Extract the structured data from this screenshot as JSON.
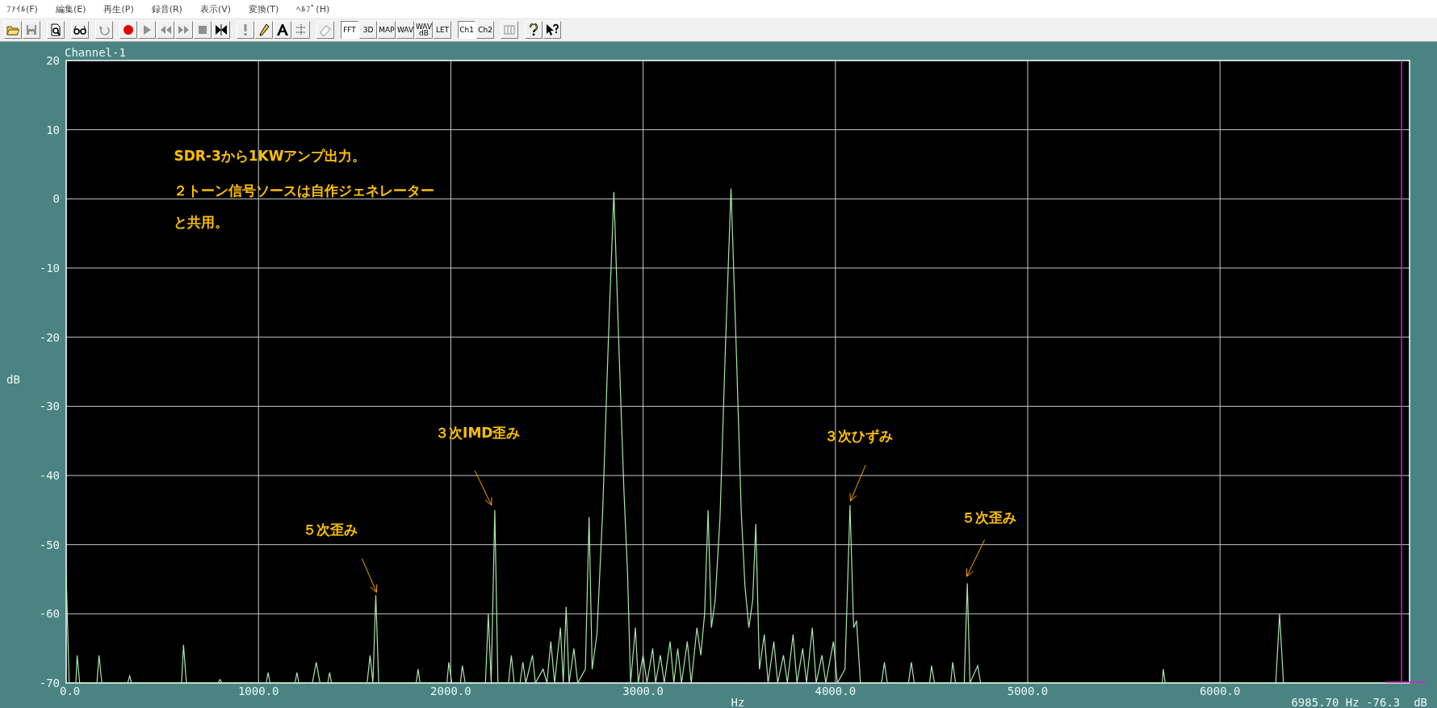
{
  "menu": [
    "ﾌｧｲﾙ(F)",
    "編集(E)",
    "再生(P)",
    "録音(R)",
    "表示(V)",
    "変換(T)",
    "ﾍﾙﾌﾟ(H)"
  ],
  "toolbar": [
    [
      {
        "kind": "open",
        "disabled": false
      },
      {
        "kind": "save",
        "disabled": true
      }
    ],
    [
      {
        "kind": "preview",
        "disabled": false
      }
    ],
    [
      {
        "kind": "glasses",
        "disabled": false
      }
    ],
    [
      {
        "kind": "undo",
        "disabled": true
      }
    ],
    [
      {
        "kind": "record",
        "disabled": false
      },
      {
        "kind": "play",
        "disabled": true
      },
      {
        "kind": "rewind",
        "disabled": true
      },
      {
        "kind": "forward",
        "disabled": true
      },
      {
        "kind": "stop",
        "disabled": true
      },
      {
        "kind": "mark",
        "disabled": false
      }
    ],
    [
      {
        "kind": "exclaim",
        "disabled": true
      },
      {
        "kind": "pencil",
        "disabled": false
      },
      {
        "kind": "font",
        "disabled": false
      },
      {
        "kind": "dots",
        "disabled": false
      }
    ],
    [
      {
        "kind": "eraser",
        "disabled": false
      }
    ],
    [
      {
        "kind": "text",
        "label": "FFT",
        "pressed": true
      },
      {
        "kind": "text",
        "label": "3D",
        "pressed": false
      },
      {
        "kind": "text",
        "label": "MAP",
        "pressed": false
      },
      {
        "kind": "text",
        "label": "WAV",
        "pressed": false
      },
      {
        "kind": "text",
        "label": "WAV\ndB",
        "pressed": false
      },
      {
        "kind": "text",
        "label": "LET",
        "pressed": false
      }
    ],
    [
      {
        "kind": "text",
        "label": "Ch1",
        "pressed": true
      },
      {
        "kind": "text",
        "label": "Ch2",
        "pressed": false
      }
    ],
    [
      {
        "kind": "columns",
        "disabled": true
      }
    ],
    [
      {
        "kind": "help",
        "disabled": false
      },
      {
        "kind": "pointerhelp",
        "disabled": false
      }
    ]
  ],
  "channel_label": "Channel-1",
  "chart_data": {
    "type": "line",
    "xlabel": "Hz",
    "ylabel": "dB",
    "xlim": [
      0,
      6985.7
    ],
    "ylim": [
      -70,
      20
    ],
    "xticks": [
      {
        "value": 0,
        "label": "0.0"
      },
      {
        "value": 1000,
        "label": "1000.0"
      },
      {
        "value": 2000,
        "label": "2000.0"
      },
      {
        "value": 3000,
        "label": "3000.0"
      },
      {
        "value": 4000,
        "label": "4000.0"
      },
      {
        "value": 5000,
        "label": "5000.0"
      },
      {
        "value": 6000,
        "label": "6000.0"
      }
    ],
    "yticks": [
      20,
      10,
      0,
      -10,
      -20,
      -30,
      -40,
      -50,
      -60,
      -70
    ],
    "x": [
      0,
      15,
      50,
      57,
      70,
      160,
      171,
      185,
      320,
      330,
      340,
      600,
      610,
      625,
      790,
      800,
      810,
      1040,
      1050,
      1060,
      1190,
      1200,
      1210,
      1280,
      1300,
      1320,
      1360,
      1370,
      1380,
      1565,
      1580,
      1595,
      1610,
      1625,
      1820,
      1830,
      1840,
      1980,
      1990,
      2005,
      2050,
      2060,
      2075,
      2180,
      2195,
      2210,
      2229,
      2245,
      2300,
      2315,
      2330,
      2360,
      2375,
      2390,
      2425,
      2440,
      2480,
      2500,
      2520,
      2540,
      2570,
      2585,
      2600,
      2615,
      2640,
      2660,
      2700,
      2719,
      2735,
      2760,
      2790,
      2820,
      2848,
      2875,
      2900,
      2919,
      2935,
      2960,
      2975,
      3000,
      3020,
      3050,
      3065,
      3090,
      3110,
      3140,
      3160,
      3180,
      3200,
      3230,
      3250,
      3280,
      3300,
      3320,
      3338,
      3355,
      3375,
      3400,
      3430,
      3457,
      3485,
      3510,
      3530,
      3550,
      3570,
      3586,
      3605,
      3630,
      3650,
      3680,
      3700,
      3730,
      3750,
      3780,
      3800,
      3830,
      3850,
      3880,
      3900,
      3930,
      3950,
      3990,
      4010,
      4050,
      4076,
      4095,
      4110,
      4130,
      4240,
      4255,
      4270,
      4380,
      4395,
      4410,
      4490,
      4500,
      4515,
      4600,
      4610,
      4625,
      4670,
      4686,
      4700,
      4740,
      4755,
      5700,
      5705,
      5715,
      6290,
      6310,
      6330,
      6985.7
    ],
    "series": [
      {
        "color": "#a8e8a8",
        "values": [
          -54,
          -70,
          -70,
          -66,
          -70,
          -70,
          -66,
          -70,
          -70,
          -69,
          -70,
          -70,
          -64.5,
          -70,
          -70,
          -69.5,
          -70,
          -70,
          -68.5,
          -70,
          -70,
          -68.5,
          -70,
          -70,
          -67,
          -70,
          -70,
          -68.5,
          -70,
          -70,
          -66,
          -70,
          -57.3,
          -70,
          -70,
          -68,
          -70,
          -70,
          -67,
          -70,
          -70,
          -67.5,
          -70,
          -70,
          -60,
          -70,
          -45,
          -70,
          -70,
          -66,
          -70,
          -70,
          -67,
          -70,
          -66,
          -70,
          -68,
          -70,
          -64,
          -70,
          -62,
          -70,
          -59,
          -70,
          -65,
          -70,
          -68,
          -46,
          -68,
          -63,
          -45,
          -20,
          1,
          -22,
          -42,
          -54,
          -70,
          -62,
          -70,
          -66,
          -70,
          -65,
          -70,
          -66,
          -70,
          -64,
          -70,
          -65,
          -70,
          -64,
          -70,
          -62,
          -66,
          -60,
          -45,
          -62,
          -58,
          -46,
          -20,
          1.5,
          -22,
          -45,
          -56,
          -62,
          -58,
          -47,
          -68,
          -63,
          -70,
          -64,
          -70,
          -66,
          -70,
          -63,
          -70,
          -65,
          -70,
          -62,
          -70,
          -66,
          -70,
          -64,
          -70,
          -68,
          -44.3,
          -62,
          -61,
          -70,
          -70,
          -67,
          -70,
          -70,
          -67,
          -70,
          -70,
          -67.5,
          -70,
          -70,
          -67,
          -70,
          -70,
          -55.6,
          -70,
          -67.5,
          -70,
          -70,
          -68,
          -70,
          -70,
          -60,
          -70,
          -70
        ]
      }
    ],
    "grid": true,
    "ref_lines": [
      {
        "axis": "x",
        "value": 6944,
        "color": "#d020d0"
      }
    ],
    "annotations": [
      "SDR-3から1KWアンプ出力。",
      "２トーン信号ソースは自作ジェネレーター",
      "と共用。",
      "３次IMD歪み",
      "５次歪み",
      "３次ひずみ",
      "５次歪み"
    ]
  },
  "readout": "6985.70 Hz -76.3  dB"
}
